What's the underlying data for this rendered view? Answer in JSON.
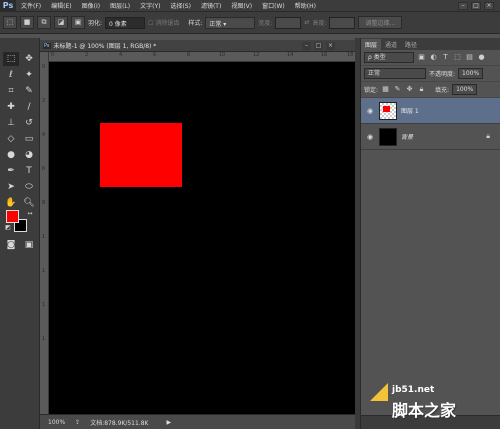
{
  "menubar": {
    "logo": "Ps",
    "items": [
      "文件(F)",
      "编辑(E)",
      "图像(I)",
      "图层(L)",
      "文字(Y)",
      "选择(S)",
      "滤镜(T)",
      "视图(V)",
      "窗口(W)",
      "帮助(H)"
    ],
    "win_controls": [
      "–",
      "□",
      "×"
    ]
  },
  "optionsbar": {
    "feather_label": "羽化:",
    "feather_value": "0 像素",
    "antialias_label": "消除锯齿",
    "style_label": "样式:",
    "style_value": "正常",
    "width_label": "宽度:",
    "height_label": "高度:",
    "refine_edge": "调整边缘..."
  },
  "document": {
    "tab_title": "未标题-1 @ 100% (图层 1, RGB/8) *",
    "tab_controls": [
      "–",
      "□",
      "×"
    ],
    "ruler_h": [
      "0",
      "2",
      "4",
      "6",
      "8",
      "10",
      "12",
      "14",
      "16",
      "18"
    ],
    "ruler_v": [
      "0",
      "2",
      "4",
      "6",
      "8",
      "1",
      "1",
      "1",
      "1"
    ]
  },
  "status": {
    "zoom": "100%",
    "doc_size": "文档:878.9K/511.8K"
  },
  "layers_panel": {
    "tabs": [
      "图层",
      "通道",
      "路径"
    ],
    "filter_kind": "ρ 类型",
    "blend_mode": "正常",
    "opacity_label": "不透明度:",
    "opacity_value": "100%",
    "lock_label": "锁定:",
    "fill_label": "填充:",
    "fill_value": "100%",
    "layers": [
      {
        "name": "图层 1",
        "selected": true
      },
      {
        "name": "背景",
        "selected": false
      }
    ]
  },
  "watermark": {
    "url": "jb51.net",
    "site_name": "脚本之家"
  },
  "colors": {
    "foreground": "#ff0000",
    "background": "#000000",
    "rect_fill": "#ff0000",
    "selected_layer": "#5d6f8a"
  }
}
